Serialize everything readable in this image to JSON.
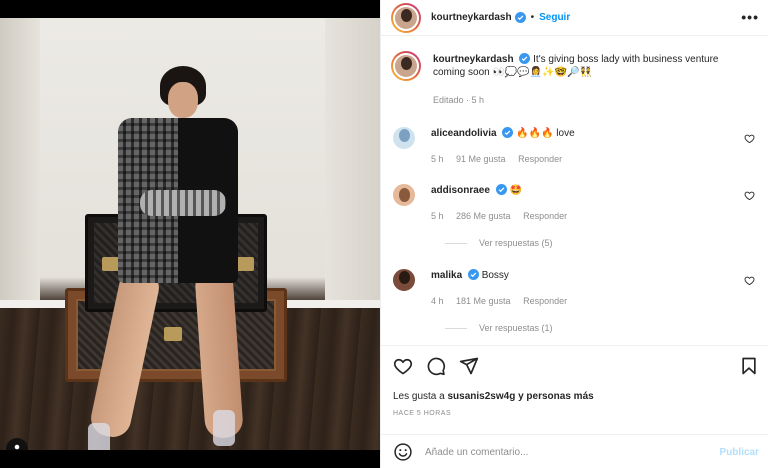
{
  "post": {
    "author": "kourtneykardash",
    "follow_label": "Seguir",
    "more_label": "•••",
    "caption": "It's giving boss lady with business venture coming soon 👀💭💬👩‍💼✨🤓🔎👯",
    "edited_label": "Editado · 5 h"
  },
  "comments": [
    {
      "author": "aliceandolivia",
      "text": "🔥🔥🔥 love",
      "time": "5 h",
      "likes": "91 Me gusta",
      "reply_label": "Responder",
      "view_replies": ""
    },
    {
      "author": "addisonraee",
      "text": "🤩",
      "time": "5 h",
      "likes": "286 Me gusta",
      "reply_label": "Responder",
      "view_replies": "Ver respuestas (5)"
    },
    {
      "author": "malika",
      "text": "Bossy",
      "time": "4 h",
      "likes": "181 Me gusta",
      "reply_label": "Responder",
      "view_replies": "Ver respuestas (1)"
    }
  ],
  "likes": {
    "prefix": "Les gusta a",
    "user": "susanis2sw4g",
    "suffix": "y personas más"
  },
  "posted_time": "HACE 5 HORAS",
  "add_comment": {
    "placeholder": "Añade un comentario...",
    "publish_label": "Publicar"
  },
  "icons": {
    "like": "heart-icon",
    "comment": "comment-icon",
    "share": "send-icon",
    "save": "bookmark-icon",
    "emoji": "emoji-icon",
    "tag": "user-tag-icon",
    "verified": "verified-badge-icon"
  },
  "colors": {
    "accent": "#0095f6",
    "verified": "#3897f0",
    "publish_disabled": "#b2dffc"
  }
}
